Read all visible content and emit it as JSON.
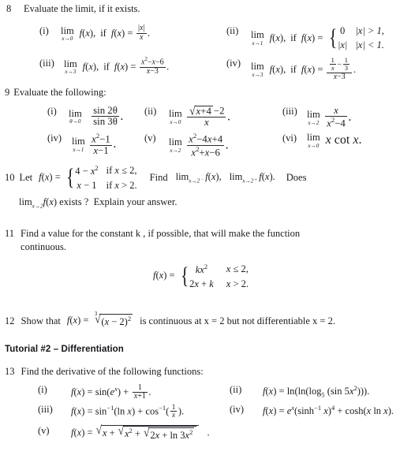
{
  "document": {
    "type": "math-worksheet",
    "title_text": "Tutorial #2 – Differentiation",
    "background_color": "#ffffff",
    "text_color": "#1c1c22"
  },
  "q8": {
    "number": "8",
    "prompt": "Evaluate the limit, if it exists.",
    "items": [
      {
        "label": "(i)",
        "text": "lim f(x), if f(x) = |x|/x.",
        "limit_var": "x",
        "limit_to": "0",
        "function": "|x| / x"
      },
      {
        "label": "(ii)",
        "text": "lim f(x), if f(x) = { 0 if |x| > 1, |x| if |x| < 1.",
        "limit_var": "x",
        "limit_to": "1",
        "case1_value": "0",
        "case1_cond": "|x| > 1,",
        "case2_value": "|x|",
        "case2_cond": "|x| < 1."
      },
      {
        "label": "(iii)",
        "text": "lim f(x), if f(x) = (x^2 - x - 6)/(x - 3).",
        "limit_var": "x",
        "limit_to": "3",
        "numerator": "x² − x − 6",
        "denominator": "x − 3"
      },
      {
        "label": "(iv)",
        "text": "lim f(x), if f(x) = (1/x - 1/3)/(x - 3).",
        "limit_var": "x",
        "limit_to": "3",
        "numerator": "1/x − 1/3",
        "denominator": "x − 3"
      }
    ]
  },
  "q9": {
    "number": "9",
    "prompt": "Evaluate the following:",
    "items": [
      {
        "label": "(i)",
        "limit_var": "θ",
        "limit_to": "0",
        "expr": "sin 2θ / sin 3θ"
      },
      {
        "label": "(ii)",
        "limit_var": "x",
        "limit_to": "0",
        "expr": "(√(x+4) − 2) / x"
      },
      {
        "label": "(iii)",
        "limit_var": "x",
        "limit_to": "2",
        "expr": "x / (x² − 4)"
      },
      {
        "label": "(iv)",
        "limit_var": "x",
        "limit_to": "1",
        "expr": "(x² − 1) / (x − 1)"
      },
      {
        "label": "(v)",
        "limit_var": "x",
        "limit_to": "2",
        "expr": "(x² − 4x + 4) / (x² + x − 6)"
      },
      {
        "label": "(vi)",
        "limit_var": "x",
        "limit_to": "0",
        "expr": "x cot x"
      }
    ]
  },
  "q10": {
    "number": "10",
    "lead": "Let",
    "fx_label": "f(x) =",
    "case1_value": "4 − x²",
    "case1_cond": "if x ≤ 2,",
    "case2_value": "x − 1",
    "case2_cond": "if x > 2.",
    "find_word": "Find",
    "limit1": "lim x→2⁻ f(x),",
    "limit2": "lim x→2⁺ f(x).",
    "does_word": "Does",
    "line2": "lim x→2 f(x) exists ?  Explain your answer."
  },
  "q11": {
    "number": "11",
    "prompt_line1": "Find  a  value  for  the  constant k ,  if  possible,  that  will  make  the  function",
    "prompt_line2": "continuous.",
    "fx_label": "f(x) =",
    "case1_value": "kx²",
    "case1_cond": "x ≤ 2,",
    "case2_value": "2x + k",
    "case2_cond": "x > 2."
  },
  "q12": {
    "number": "12",
    "text_before": "Show that",
    "function": "f(x) = ∛((x − 2)²)",
    "text_after": "is continuous at  x = 2  but not differentiable  x = 2."
  },
  "tutorial": {
    "heading": "Tutorial #2 – Differentiation"
  },
  "q13": {
    "number": "13",
    "prompt": "Find the derivative of the following functions:",
    "items": [
      {
        "label": "(i)",
        "expr": "f(x) = sin(eˣ) + 1/(x+1)."
      },
      {
        "label": "(ii)",
        "expr": "f(x) = ln(ln(log₅ (sin 5x²)))."
      },
      {
        "label": "(iii)",
        "expr": "f(x) = sin⁻¹(ln x) + cos⁻¹(1/x)."
      },
      {
        "label": "(iv)",
        "expr": "f(x) = eˣ(sinh⁻¹ x)⁴ + cosh(x ln x)."
      },
      {
        "label": "(v)",
        "expr": "f(x) = √(x + √(x² + √(2x + ln 3x²)))."
      }
    ]
  }
}
